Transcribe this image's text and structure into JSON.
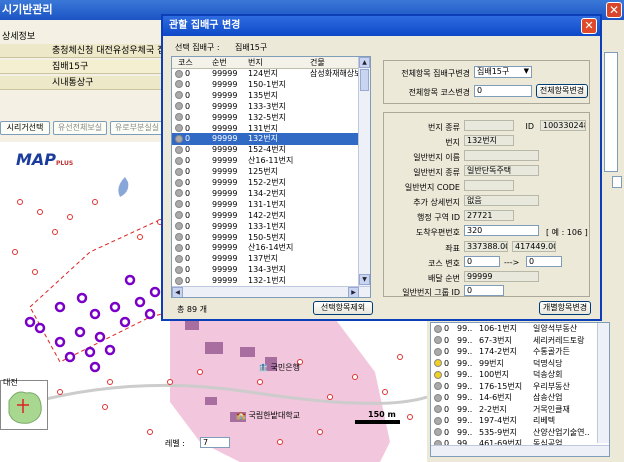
{
  "app": {
    "title": "시기반관리",
    "detail_label": "상세정보",
    "rows": [
      "충청체신청 대전유성우체국 집배",
      "집배15구",
      "시내통상구"
    ],
    "buttons": [
      "시리거선택",
      "유선전체보실",
      "유로부분실실"
    ],
    "level_label": "레벨 :",
    "level_value": "7",
    "logo_text": "MAP",
    "logo_sub": "PLUS"
  },
  "map_labels": {
    "bank": "국민은행",
    "school": "국립한밭대학교",
    "scale": "150 m",
    "city": "대전"
  },
  "right_list": [
    {
      "c": "0",
      "s": "99..",
      "b": "106-1번지",
      "n": "일양석부동산"
    },
    {
      "c": "0",
      "s": "99..",
      "b": "67-3번지",
      "n": "세리커레드토랑"
    },
    {
      "c": "0",
      "s": "99..",
      "b": "174-2번지",
      "n": "수통골가든"
    },
    {
      "c": "0",
      "s": "99..",
      "b": "99번지",
      "n": "덕명식당"
    },
    {
      "c": "0",
      "s": "99..",
      "b": "100번지",
      "n": "덕송상회"
    },
    {
      "c": "0",
      "s": "99..",
      "b": "176-15번지",
      "n": "우리부동산"
    },
    {
      "c": "0",
      "s": "99..",
      "b": "14-6번지",
      "n": "삼송산업"
    },
    {
      "c": "0",
      "s": "99..",
      "b": "2-2번지",
      "n": "거목인클재"
    },
    {
      "c": "0",
      "s": "99..",
      "b": "197-4번지",
      "n": "리베텍"
    },
    {
      "c": "0",
      "s": "99..",
      "b": "535-9번지",
      "n": "산양산업기술연.."
    },
    {
      "c": "0",
      "s": "99..",
      "b": "461-69번지",
      "n": "동심공업"
    }
  ],
  "dialog": {
    "title": "관할 집배구 변경",
    "selected_label": "선택 집배구 :",
    "selected_value": "집배15구",
    "columns": [
      "코스",
      "순번",
      "번지",
      "건물"
    ],
    "rows": [
      {
        "c": "0",
        "s": "99999",
        "b": "124번지",
        "g": "삼성화재해상보"
      },
      {
        "c": "0",
        "s": "99999",
        "b": "150-1번지",
        "g": ""
      },
      {
        "c": "0",
        "s": "99999",
        "b": "135번지",
        "g": ""
      },
      {
        "c": "0",
        "s": "99999",
        "b": "133-3번지",
        "g": ""
      },
      {
        "c": "0",
        "s": "99999",
        "b": "132-5번지",
        "g": ""
      },
      {
        "c": "0",
        "s": "99999",
        "b": "131번지",
        "g": ""
      },
      {
        "c": "0",
        "s": "99999",
        "b": "132번지",
        "g": ""
      },
      {
        "c": "0",
        "s": "99999",
        "b": "152-4번지",
        "g": ""
      },
      {
        "c": "0",
        "s": "99999",
        "b": "산16-11번지",
        "g": ""
      },
      {
        "c": "0",
        "s": "99999",
        "b": "125번지",
        "g": ""
      },
      {
        "c": "0",
        "s": "99999",
        "b": "152-2번지",
        "g": ""
      },
      {
        "c": "0",
        "s": "99999",
        "b": "134-2번지",
        "g": ""
      },
      {
        "c": "0",
        "s": "99999",
        "b": "131-1번지",
        "g": ""
      },
      {
        "c": "0",
        "s": "99999",
        "b": "142-2번지",
        "g": ""
      },
      {
        "c": "0",
        "s": "99999",
        "b": "133-1번지",
        "g": ""
      },
      {
        "c": "0",
        "s": "99999",
        "b": "150-5번지",
        "g": ""
      },
      {
        "c": "0",
        "s": "99999",
        "b": "산16-14번지",
        "g": ""
      },
      {
        "c": "0",
        "s": "99999",
        "b": "137번지",
        "g": ""
      },
      {
        "c": "0",
        "s": "99999",
        "b": "134-3번지",
        "g": ""
      },
      {
        "c": "0",
        "s": "99999",
        "b": "132-1번지",
        "g": ""
      }
    ],
    "selected_row_index": 6,
    "total_label": "총 89 개",
    "exclude_button": "선택항목제외",
    "all_zone_label": "전체항목 집배구변경",
    "all_zone_value": "집배15구",
    "all_course_label": "전체항목 코스변경",
    "all_course_value": "0",
    "all_change_button": "전체항목변경",
    "fields": {
      "bunji_kind_label": "번지 종류",
      "bunji_kind_value": "",
      "id_label": "ID",
      "id_value": "100330248",
      "bunji_label": "번지",
      "bunji_value": "132번지",
      "general_name_label": "일반번지 이름",
      "general_name_value": "",
      "general_kind_label": "일반번지 종류",
      "general_kind_value": "일반단독주택",
      "general_code_label": "일반번지 CODE",
      "general_code_value": "",
      "extra_label": "추가 상세번지",
      "extra_value": "없음",
      "admin_label": "행정 구역 ID",
      "admin_value": "27721",
      "road_label": "도착우편번호",
      "road_value": "320",
      "example_text": "[ 예 : 106 ]",
      "coord_label": "좌표",
      "coord_x": "337388.00",
      "coord_y": "417449.00",
      "course_label": "코스 변호",
      "course_from": "0",
      "arrow": "--->",
      "course_to": "0",
      "seq_label": "배달 순번",
      "seq_value": "99999",
      "group_label": "일반번지 그룹 ID",
      "group_value": "0"
    },
    "each_change_button": "개별항목변경"
  }
}
